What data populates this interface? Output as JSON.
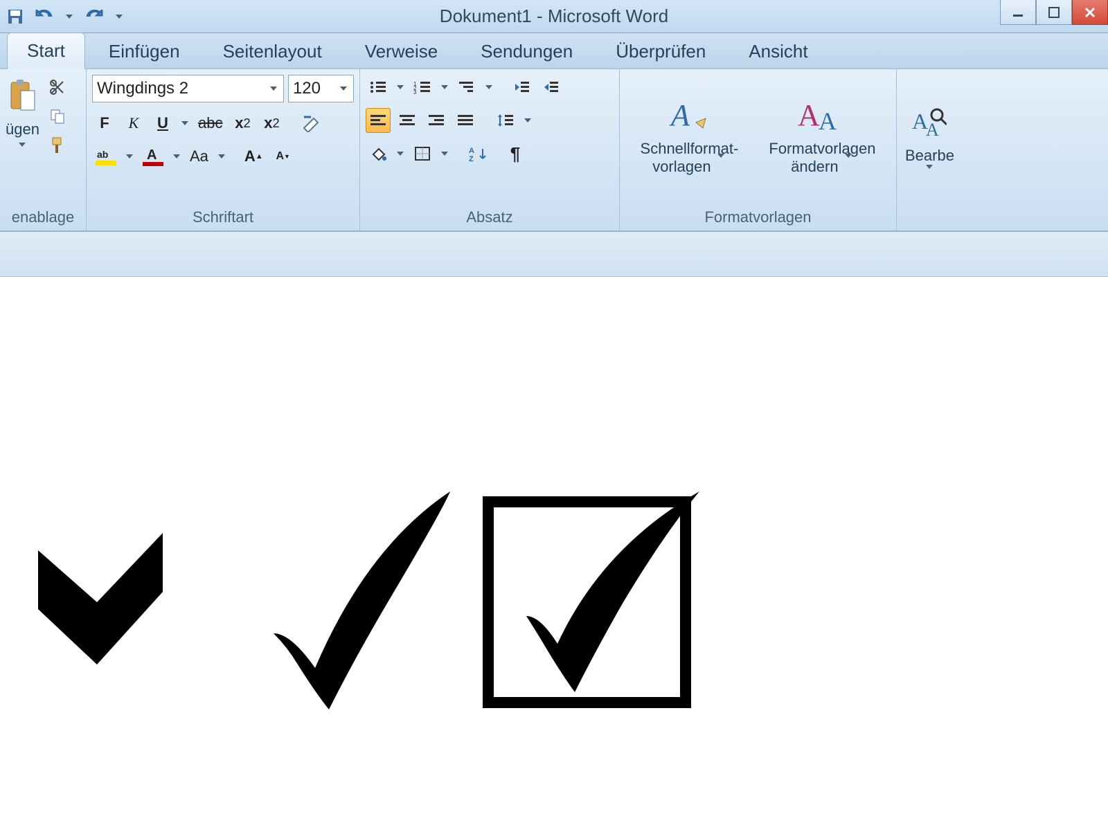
{
  "title": "Dokument1 - Microsoft Word",
  "tabs": [
    "Start",
    "Einfügen",
    "Seitenlayout",
    "Verweise",
    "Sendungen",
    "Überprüfen",
    "Ansicht"
  ],
  "clipboard": {
    "paste": "ügen",
    "group": "enablage"
  },
  "font": {
    "name": "Wingdings 2",
    "size": "120",
    "group": "Schriftart",
    "bold": "F",
    "italic": "K",
    "underline": "U",
    "strike": "abc",
    "caseMenu": "Aa"
  },
  "paragraph": {
    "group": "Absatz"
  },
  "styles": {
    "group": "Formatvorlagen",
    "quick1": "Schnellformat-",
    "quick2": "vorlagen",
    "change1": "Formatvorlagen",
    "change2": "ändern"
  },
  "edit": {
    "label": "Bearbe"
  }
}
